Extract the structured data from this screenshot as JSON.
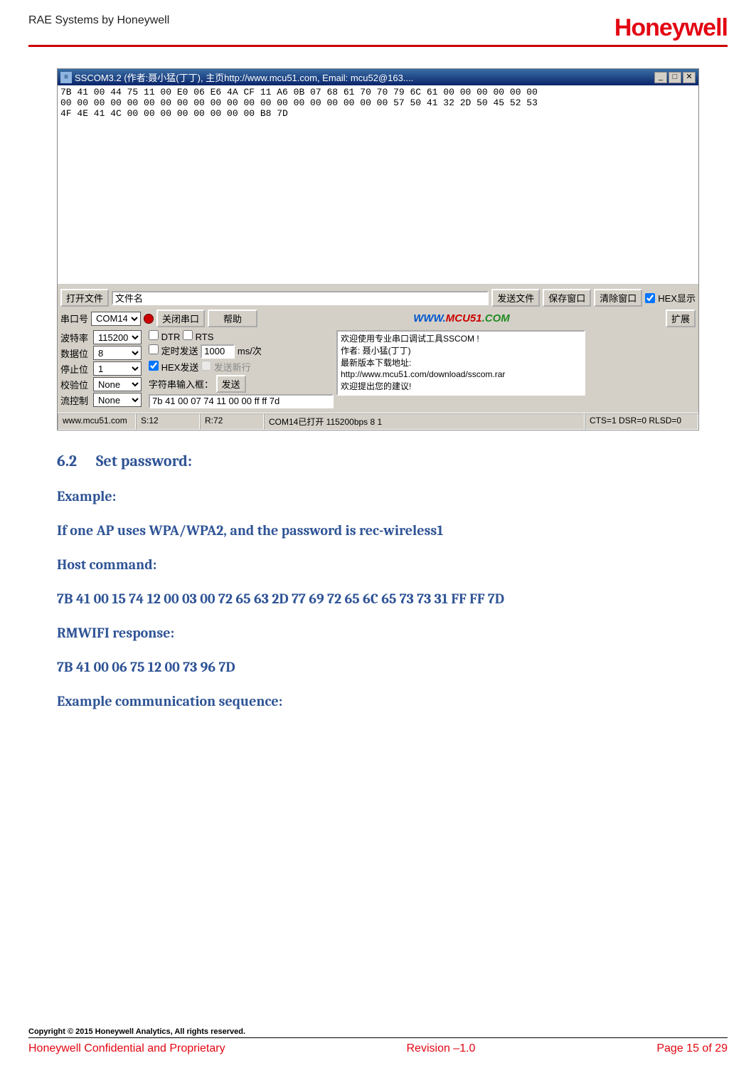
{
  "header": {
    "left": "RAE Systems by Honeywell",
    "logo": "Honeywell"
  },
  "sscom": {
    "title": "SSCOM3.2 (作者:聂小猛(丁丁), 主页http://www.mcu51.com,  Email: mcu52@163....",
    "min_icon": "_",
    "max_icon": "□",
    "close_icon": "✕",
    "hex_output": "7B 41 00 44 75 11 00 E0 06 E6 4A CF 11 A6 0B 07 68 61 70 70 79 6C 61 00 00 00 00 00 00\n00 00 00 00 00 00 00 00 00 00 00 00 00 00 00 00 00 00 00 00 57 50 41 32 2D 50 45 52 53\n4F 4E 41 4C 00 00 00 00 00 00 00 00 B8 7D",
    "row1": {
      "open_file": "打开文件",
      "filename_value": "文件名",
      "send_file": "发送文件",
      "save_window": "保存窗口",
      "clear_window": "清除窗口",
      "hex_display": "HEX显示"
    },
    "row2": {
      "port_label": "串口号",
      "port_value": "COM14",
      "close_port": "关闭串口",
      "help": "帮助",
      "url_www": "WWW.",
      "url_mcu": "MCU51",
      "url_com": ".COM",
      "expand": "扩展"
    },
    "left_params": {
      "baud_label": "波特率",
      "baud_value": "115200",
      "data_label": "数据位",
      "data_value": "8",
      "stop_label": "停止位",
      "stop_value": "1",
      "parity_label": "校验位",
      "parity_value": "None",
      "flow_label": "流控制",
      "flow_value": "None"
    },
    "mid": {
      "dtr": "DTR",
      "rts": "RTS",
      "timed_send": "定时发送",
      "interval_value": "1000",
      "interval_unit": "ms/次",
      "hex_send": "HEX发送",
      "send_newline": "发送新行",
      "input_label": "字符串输入框：",
      "send_btn": "发送",
      "cmd_value": "7b 41 00 07 74 11 00 00 ff ff 7d"
    },
    "info_box": "欢迎使用专业串口调试工具SSCOM !\n作者: 聂小猛(丁丁)\n最新版本下载地址:\nhttp://www.mcu51.com/download/sscom.rar\n欢迎提出您的建议!",
    "statusbar": {
      "c1": "www.mcu51.com",
      "c2": "S:12",
      "c3": "R:72",
      "c4": "COM14已打开  115200bps  8 1",
      "c5": "CTS=1 DSR=0 RLSD=0"
    }
  },
  "doc": {
    "heading_num": "6.2",
    "heading_text": "Set password:",
    "p1": "Example:",
    "p2": "If one AP uses WPA/WPA2,  and the password is rec-wireless1",
    "p3": "Host command:",
    "p4": "7B 41 00 15 74 12 00 03 00 72 65 63 2D 77 69 72 65 6C 65 73 73 31 FF FF 7D",
    "p5": "RMWIFI response:",
    "p6": "7B 41 00 06 75 12 00 73 96 7D",
    "p7": "Example communication sequence:"
  },
  "footer": {
    "copyright": "Copyright © 2015 Honeywell Analytics, All rights reserved.",
    "left": "Honeywell Confidential and Proprietary",
    "center": "Revision –1.0",
    "right": "Page 15 of 29"
  }
}
